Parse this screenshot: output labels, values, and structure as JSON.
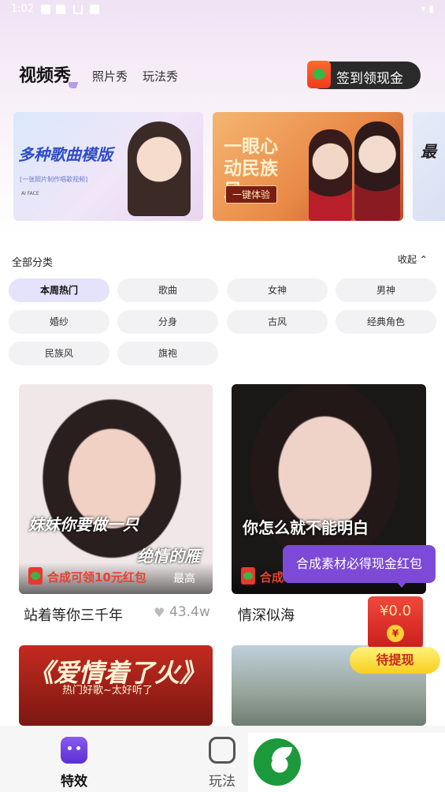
{
  "status_bar": {
    "time": "1:02"
  },
  "header": {
    "tabs": [
      {
        "label": "视频秀",
        "active": true
      },
      {
        "label": "照片秀",
        "active": false
      },
      {
        "label": "玩法秀",
        "active": false
      }
    ],
    "checkin_label": "签到领现金"
  },
  "banners": [
    {
      "title": "多种歌曲模版",
      "subtitle": "[一张照片制作唱歌视频]",
      "tag": "AI FACE"
    },
    {
      "title": "一眼心动民族风",
      "button": "一键体验"
    },
    {
      "title": "最"
    }
  ],
  "category_panel": {
    "title": "全部分类",
    "collapse_label": "收起 ⌃",
    "chips": [
      "本周热门",
      "歌曲",
      "女神",
      "男神",
      "婚纱",
      "分身",
      "古风",
      "经典角色",
      "民族风",
      "旗袍"
    ],
    "active_chip": "本周热门"
  },
  "feed": [
    {
      "lyric_line1": "妹妹你要做一只",
      "lyric_line2": "绝情的雁",
      "promo": "合成可领10元红包",
      "promo_suffix": "最高",
      "title": "站着等你三千年",
      "likes": "43.4w"
    },
    {
      "lyric_line1": "你怎么就不能明白",
      "promo": "合成",
      "title": "情深似海"
    },
    {
      "title_art": "《爱情着了火》",
      "subtitle_art": "热门好歌~太好听了"
    },
    {}
  ],
  "tooltip": "合成素材必得现金红包",
  "wallet": {
    "amount": "¥0.0",
    "coin": "¥",
    "button": "待提现"
  },
  "bottom_nav": [
    {
      "label": "特效",
      "active": true,
      "icon": "effects-icon"
    },
    {
      "label": "玩法",
      "active": false,
      "icon": "gameplay-icon"
    }
  ],
  "colors": {
    "accent": "#7c4ad6",
    "chip_active": "#e5e2fb",
    "red": "#e8392d"
  }
}
